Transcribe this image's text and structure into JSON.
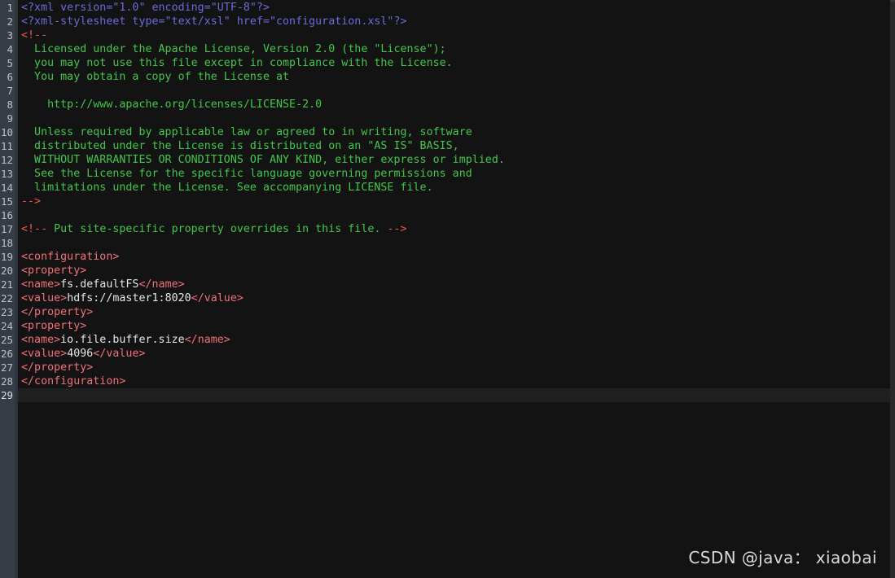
{
  "editor": {
    "theme_colors": {
      "background": "#131313",
      "gutter_background": "#353c44",
      "gutter_border": "#2c333b",
      "line_number": "#b9c2cb",
      "active_line": "#1f2021",
      "processing_instruction": "#6b6bdc",
      "comment": "#43c74a",
      "comment_delimiter": "#f2594b",
      "tag": "#f07178",
      "text": "#e6e6e6"
    },
    "total_lines": 29,
    "active_line": 29,
    "language": "xml",
    "lines": [
      {
        "n": 1,
        "tokens": [
          {
            "c": "t-pi",
            "s": "<?xml version=\"1.0\" encoding=\"UTF-8\"?>"
          }
        ]
      },
      {
        "n": 2,
        "tokens": [
          {
            "c": "t-pi",
            "s": "<?xml-stylesheet type=\"text/xsl\" href=\"configuration.xsl\"?>"
          }
        ]
      },
      {
        "n": 3,
        "tokens": [
          {
            "c": "t-cmtd",
            "s": "<!--"
          }
        ]
      },
      {
        "n": 4,
        "tokens": [
          {
            "c": "t-cmt",
            "s": "  Licensed under the Apache License, Version 2.0 (the \"License\");"
          }
        ]
      },
      {
        "n": 5,
        "tokens": [
          {
            "c": "t-cmt",
            "s": "  you may not use this file except in compliance with the License."
          }
        ]
      },
      {
        "n": 6,
        "tokens": [
          {
            "c": "t-cmt",
            "s": "  You may obtain a copy of the License at"
          }
        ]
      },
      {
        "n": 7,
        "tokens": [
          {
            "c": "t-cmt",
            "s": ""
          }
        ]
      },
      {
        "n": 8,
        "tokens": [
          {
            "c": "t-cmt",
            "s": "    http://www.apache.org/licenses/LICENSE-2.0"
          }
        ]
      },
      {
        "n": 9,
        "tokens": [
          {
            "c": "t-cmt",
            "s": ""
          }
        ]
      },
      {
        "n": 10,
        "tokens": [
          {
            "c": "t-cmt",
            "s": "  Unless required by applicable law or agreed to in writing, software"
          }
        ]
      },
      {
        "n": 11,
        "tokens": [
          {
            "c": "t-cmt",
            "s": "  distributed under the License is distributed on an \"AS IS\" BASIS,"
          }
        ]
      },
      {
        "n": 12,
        "tokens": [
          {
            "c": "t-cmt",
            "s": "  WITHOUT WARRANTIES OR CONDITIONS OF ANY KIND, either express or implied."
          }
        ]
      },
      {
        "n": 13,
        "tokens": [
          {
            "c": "t-cmt",
            "s": "  See the License for the specific language governing permissions and"
          }
        ]
      },
      {
        "n": 14,
        "tokens": [
          {
            "c": "t-cmt",
            "s": "  limitations under the License. See accompanying LICENSE file."
          }
        ]
      },
      {
        "n": 15,
        "tokens": [
          {
            "c": "t-cmtd",
            "s": "-->"
          }
        ]
      },
      {
        "n": 16,
        "tokens": [
          {
            "c": "t-txt",
            "s": ""
          }
        ]
      },
      {
        "n": 17,
        "tokens": [
          {
            "c": "t-cmtd",
            "s": "<!--"
          },
          {
            "c": "t-cmt",
            "s": " Put site-specific property overrides in this file. "
          },
          {
            "c": "t-cmtd",
            "s": "-->"
          }
        ]
      },
      {
        "n": 18,
        "tokens": [
          {
            "c": "t-txt",
            "s": ""
          }
        ]
      },
      {
        "n": 19,
        "tokens": [
          {
            "c": "t-tag",
            "s": "<configuration>"
          }
        ]
      },
      {
        "n": 20,
        "tokens": [
          {
            "c": "t-tag",
            "s": "<property>"
          }
        ]
      },
      {
        "n": 21,
        "tokens": [
          {
            "c": "t-tag",
            "s": "<name>"
          },
          {
            "c": "t-txt",
            "s": "fs.defaultFS"
          },
          {
            "c": "t-tag",
            "s": "</name>"
          }
        ]
      },
      {
        "n": 22,
        "tokens": [
          {
            "c": "t-tag",
            "s": "<value>"
          },
          {
            "c": "t-txt",
            "s": "hdfs://master1:8020"
          },
          {
            "c": "t-tag",
            "s": "</value>"
          }
        ]
      },
      {
        "n": 23,
        "tokens": [
          {
            "c": "t-tag",
            "s": "</property>"
          }
        ]
      },
      {
        "n": 24,
        "tokens": [
          {
            "c": "t-tag",
            "s": "<property>"
          }
        ]
      },
      {
        "n": 25,
        "tokens": [
          {
            "c": "t-tag",
            "s": "<name>"
          },
          {
            "c": "t-txt",
            "s": "io.file.buffer.size"
          },
          {
            "c": "t-tag",
            "s": "</name>"
          }
        ]
      },
      {
        "n": 26,
        "tokens": [
          {
            "c": "t-tag",
            "s": "<value>"
          },
          {
            "c": "t-txt",
            "s": "4096"
          },
          {
            "c": "t-tag",
            "s": "</value>"
          }
        ]
      },
      {
        "n": 27,
        "tokens": [
          {
            "c": "t-tag",
            "s": "</property>"
          }
        ]
      },
      {
        "n": 28,
        "tokens": [
          {
            "c": "t-tag",
            "s": "</configuration>"
          }
        ]
      },
      {
        "n": 29,
        "tokens": [
          {
            "c": "t-txt",
            "s": ""
          }
        ]
      }
    ]
  },
  "watermark": {
    "text": "CSDN @java： xiaobai"
  }
}
